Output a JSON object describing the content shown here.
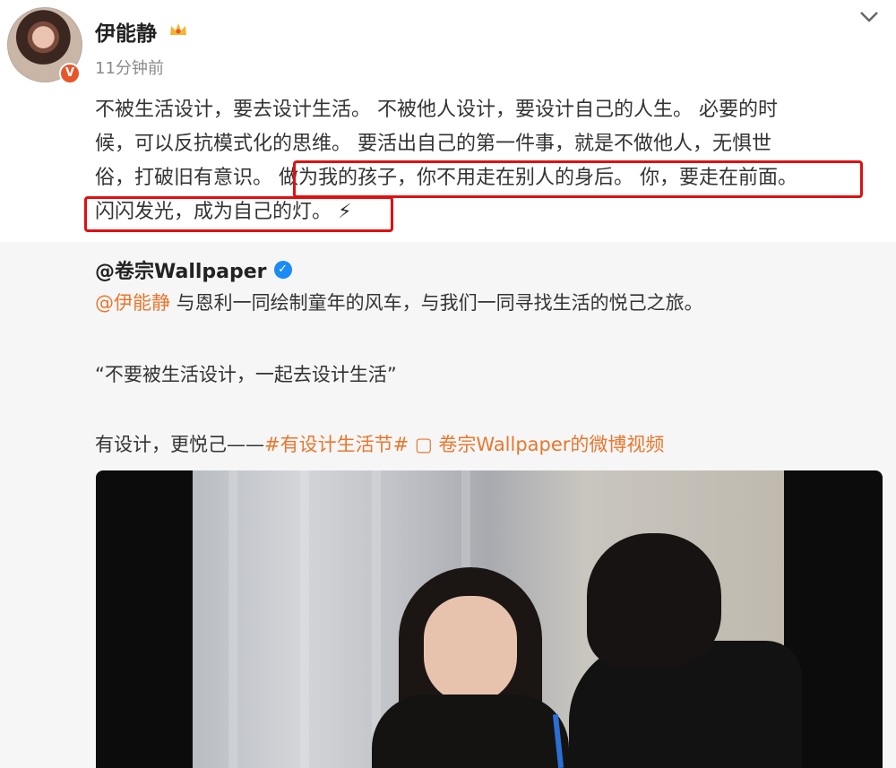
{
  "post": {
    "author": "伊能静",
    "badge_icon": "crown-icon",
    "verified_mark": "V",
    "time": "11分钟前",
    "lines": [
      "不被生活设计，要去设计生活。 不被他人设计，要设计自己的人生。 必要的时",
      "候，可以反抗模式化的思维。 要活出自己的第一件事，就是不做他人，无惧世",
      "俗，打破旧有意识。 做为我的孩子，你不用走在别人的身后。 你，要走在前面。",
      "闪闪发光，成为自己的灯。 ⚡"
    ],
    "highlight_color": "#e01010"
  },
  "repost": {
    "author": "@卷宗Wallpaper",
    "verified_mark": "✓",
    "mention": "@伊能静",
    "line1_rest": " 与恩利一同绘制童年的风车，与我们一同寻找生活的悦己之旅。",
    "quote": "“不要被生活设计，一起去设计生活”",
    "tagline_prefix": "有设计，更悦己——",
    "hashtag": "#有设计生活节#",
    "video_link": " ▢ 卷宗Wallpaper的微博视频",
    "link_color": "#e8772e"
  }
}
